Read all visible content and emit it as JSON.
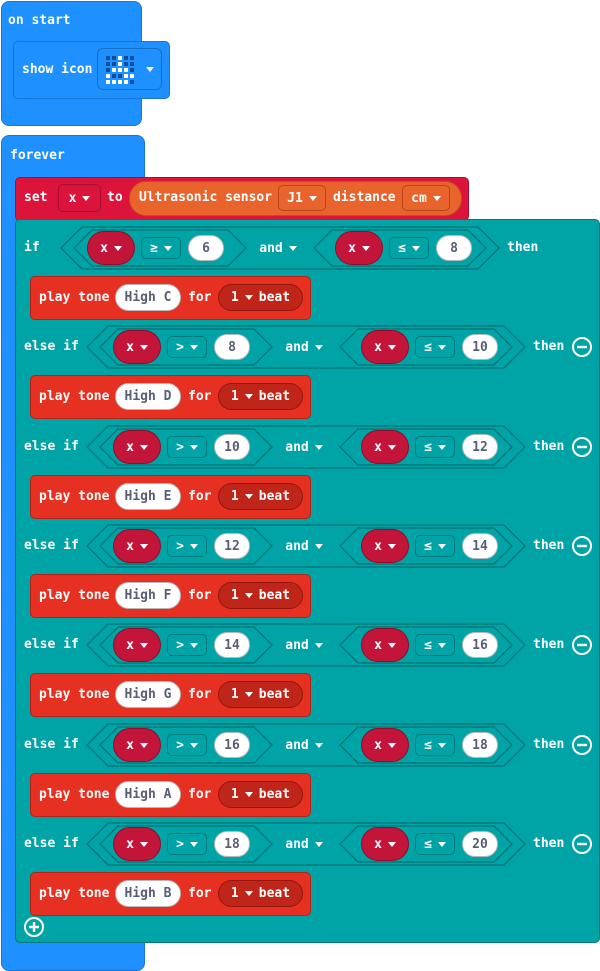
{
  "on_start": {
    "hat_label": "on start",
    "show_icon_label": "show icon"
  },
  "forever": {
    "label": "forever",
    "set": {
      "set_label": "set",
      "variable": "x",
      "to_label": "to",
      "sensor_label": "Ultrasonic sensor",
      "port": "J1",
      "distance_label": "distance",
      "unit": "cm"
    },
    "if_label": "if",
    "else_if_label": "else if",
    "then_label": "then",
    "and_label": "and",
    "play_tone_label": "play tone",
    "for_label": "for",
    "beat_value": "1",
    "beat_label": "beat",
    "branches": [
      {
        "left_op": "≥",
        "left_val": "6",
        "right_op": "≤",
        "right_val": "8",
        "note": "High C"
      },
      {
        "left_op": ">",
        "left_val": "8",
        "right_op": "≤",
        "right_val": "10",
        "note": "High D"
      },
      {
        "left_op": ">",
        "left_val": "10",
        "right_op": "≤",
        "right_val": "12",
        "note": "High E"
      },
      {
        "left_op": ">",
        "left_val": "12",
        "right_op": "≤",
        "right_val": "14",
        "note": "High F"
      },
      {
        "left_op": ">",
        "left_val": "14",
        "right_op": "≤",
        "right_val": "16",
        "note": "High G"
      },
      {
        "left_op": ">",
        "left_val": "16",
        "right_op": "≤",
        "right_val": "18",
        "note": "High A"
      },
      {
        "left_op": ">",
        "left_val": "18",
        "right_op": "≤",
        "right_val": "20",
        "note": "High B"
      }
    ]
  },
  "colors": {
    "basic_blue": "#1e90ff",
    "variables_red": "#dc143c",
    "logic_teal": "#00a4a6",
    "music_red": "#e63022",
    "sensor_orange": "#e9642d"
  }
}
